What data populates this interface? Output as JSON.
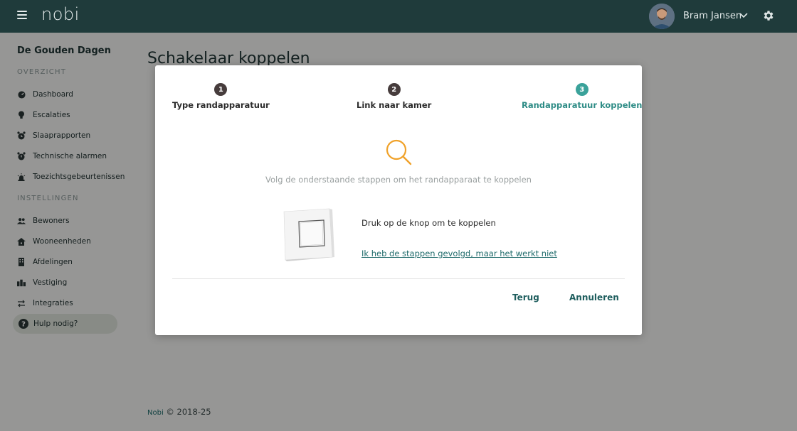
{
  "topbar": {
    "logo": "nobi",
    "user_name": "Bram Jansen"
  },
  "sidebar": {
    "org_name": "De Gouden Dagen",
    "section_overview": "OVERZICHT",
    "overview_items": [
      {
        "label": "Dashboard",
        "icon": "dashboard-icon"
      },
      {
        "label": "Escalaties",
        "icon": "bulb-icon"
      },
      {
        "label": "Slaaprapporten",
        "icon": "alarm-clock-icon"
      },
      {
        "label": "Technische alarmen",
        "icon": "alarm-icon"
      },
      {
        "label": "Toezichtsgebeurtenissen",
        "icon": "siren-icon"
      }
    ],
    "section_settings": "INSTELLINGEN",
    "settings_items": [
      {
        "label": "Bewoners",
        "icon": "users-icon"
      },
      {
        "label": "Wooneenheden",
        "icon": "home-icon"
      },
      {
        "label": "Afdelingen",
        "icon": "building-icon"
      },
      {
        "label": "Vestiging",
        "icon": "city-icon"
      },
      {
        "label": "Integraties",
        "icon": "swap-icon"
      }
    ],
    "help_label": "Hulp nodig?"
  },
  "page": {
    "title": "Schakelaar koppelen",
    "footer_brand": "Nobi",
    "footer_text": "© 2018-25"
  },
  "modal": {
    "steps": [
      {
        "num": "1",
        "label": "Type randapparatuur",
        "active": false
      },
      {
        "num": "2",
        "label": "Link naar kamer",
        "active": false
      },
      {
        "num": "3",
        "label": "Randapparatuur koppelen",
        "active": true
      }
    ],
    "instruction": "Volg de onderstaande stappen om het randapparaat te koppelen",
    "press_text": "Druk op de knop om te koppelen",
    "help_link": "Ik heb de stappen gevolgd, maar het werkt niet",
    "back_button": "Terug",
    "cancel_button": "Annuleren"
  },
  "colors": {
    "topbar": "#1f3b3b",
    "accent": "#3aa29a",
    "search_icon": "#f0a22a"
  }
}
